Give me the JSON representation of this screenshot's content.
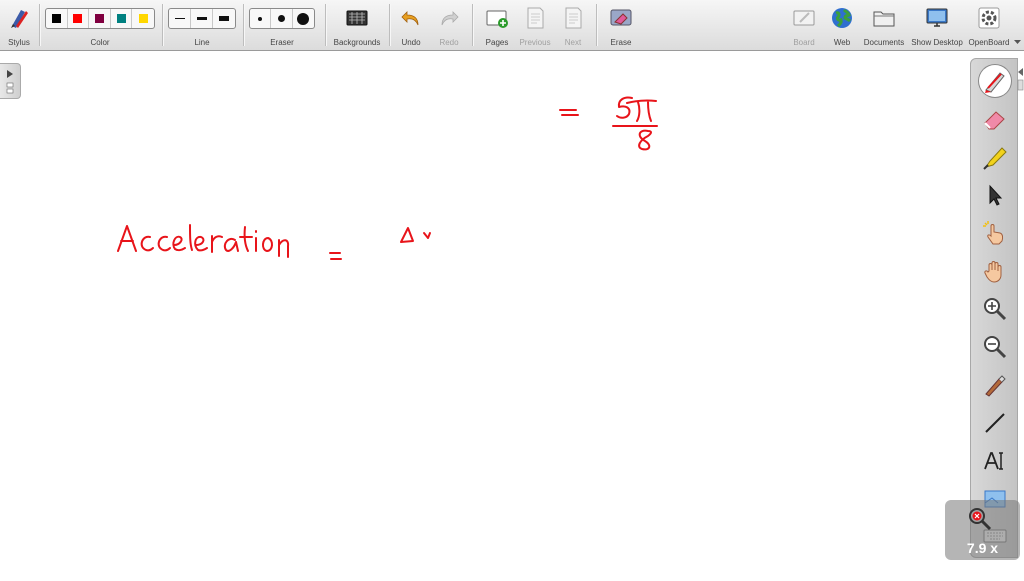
{
  "toolbar": {
    "stylus_label": "Stylus",
    "color_label": "Color",
    "line_label": "Line",
    "eraser_label": "Eraser",
    "backgrounds_label": "Backgrounds",
    "undo_label": "Undo",
    "redo_label": "Redo",
    "pages_label": "Pages",
    "previous_label": "Previous",
    "next_label": "Next",
    "erase_label": "Erase",
    "board_label": "Board",
    "web_label": "Web",
    "documents_label": "Documents",
    "show_desktop_label": "Show Desktop",
    "openboard_label": "OpenBoard",
    "colors": [
      "#000000",
      "#ff0000",
      "#800040",
      "#008080",
      "#ffd700"
    ],
    "selected_color": "#ff0000"
  },
  "board": {
    "word": "Acceleration",
    "ink_color": "#e8141a"
  },
  "right_panel": {
    "tools": [
      "pen-icon",
      "eraser-icon",
      "highlighter-icon",
      "pointer-icon",
      "laser-pointer-icon",
      "hand-icon",
      "zoom-in-icon",
      "zoom-out-icon",
      "capture-pen-icon",
      "line-icon",
      "text-icon",
      "screenshot-icon",
      "keyboard-icon"
    ]
  },
  "zoom": {
    "level": "7.9 x"
  }
}
